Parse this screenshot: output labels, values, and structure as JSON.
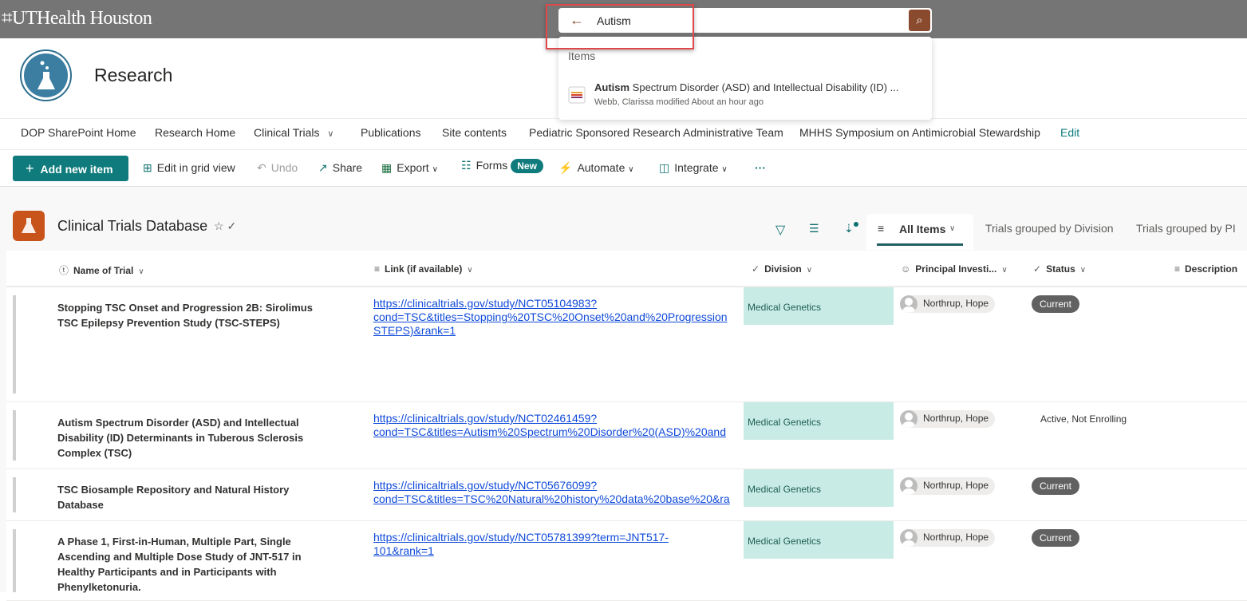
{
  "topbar": {
    "logo": "UTHealth Houston",
    "search_value": "Autism",
    "colors": {
      "bar": "#757575",
      "search_button": "#8a4a2e",
      "highlight": "#e0484a"
    }
  },
  "search_dropdown": {
    "header": "Items",
    "result": {
      "bold": "Autism",
      "rest": " Spectrum Disorder (ASD) and Intellectual Disability (ID) ...",
      "meta": "Webb, Clarissa modified About an hour ago",
      "icon": "list-document-icon"
    }
  },
  "site": {
    "title": "Research",
    "icon": "flask-icon"
  },
  "nav": {
    "items": [
      "DOP SharePoint Home",
      "Research Home",
      "Clinical Trials",
      "Publications",
      "Site contents",
      "Pediatric Sponsored Research Administrative Team",
      "MHHS Symposium on Antimicrobial Stewardship"
    ],
    "edit": "Edit"
  },
  "toolbar": {
    "add": "Add new item",
    "grid": "Edit in grid view",
    "undo": "Undo",
    "share": "Share",
    "export": "Export",
    "forms": "Forms",
    "forms_badge": "New",
    "automate": "Automate",
    "integrate": "Integrate",
    "more": "···",
    "accent": "#0f7b7c"
  },
  "list": {
    "title": "Clinical Trials Database",
    "views": {
      "active": "All Items",
      "other": [
        "Trials grouped by Division",
        "Trials grouped by PI"
      ]
    }
  },
  "columns": [
    "Name of Trial",
    "Link (if available)",
    "Division",
    "Principal Investi...",
    "Status",
    "Description"
  ],
  "rows": [
    {
      "name": "Stopping TSC Onset and Progression 2B: Sirolimus TSC Epilepsy Prevention Study (TSC-STEPS)",
      "link": [
        "https://clinicaltrials.gov/study/NCT05104983?",
        "cond=TSC&titles=Stopping%20TSC%20Onset%20and%20Progression",
        "STEPS)&rank=1"
      ],
      "division": "Medical Genetics",
      "pi": "Northrup, Hope",
      "status": "Current",
      "status_pill": true
    },
    {
      "name": "Autism Spectrum Disorder (ASD) and Intellectual Disability (ID) Determinants in Tuberous Sclerosis Complex (TSC)",
      "link": [
        "https://clinicaltrials.gov/study/NCT02461459?",
        "cond=TSC&titles=Autism%20Spectrum%20Disorder%20(ASD)%20and"
      ],
      "division": "Medical Genetics",
      "pi": "Northrup, Hope",
      "status": "Active, Not Enrolling",
      "status_pill": false
    },
    {
      "name": "TSC Biosample Repository and Natural History Database",
      "link": [
        "https://clinicaltrials.gov/study/NCT05676099?",
        "cond=TSC&titles=TSC%20Natural%20history%20data%20base%20&ra"
      ],
      "division": "Medical Genetics",
      "pi": "Northrup, Hope",
      "status": "Current",
      "status_pill": true
    },
    {
      "name": "A Phase 1, First-in-Human, Multiple Part, Single Ascending and Multiple Dose Study of JNT-517 in Healthy Participants and in Participants with Phenylketonuria.",
      "link": [
        "https://clinicaltrials.gov/study/NCT05781399?term=JNT517-",
        "101&rank=1"
      ],
      "division": "Medical Genetics",
      "pi": "Northrup, Hope",
      "status": "Current",
      "status_pill": true
    }
  ]
}
